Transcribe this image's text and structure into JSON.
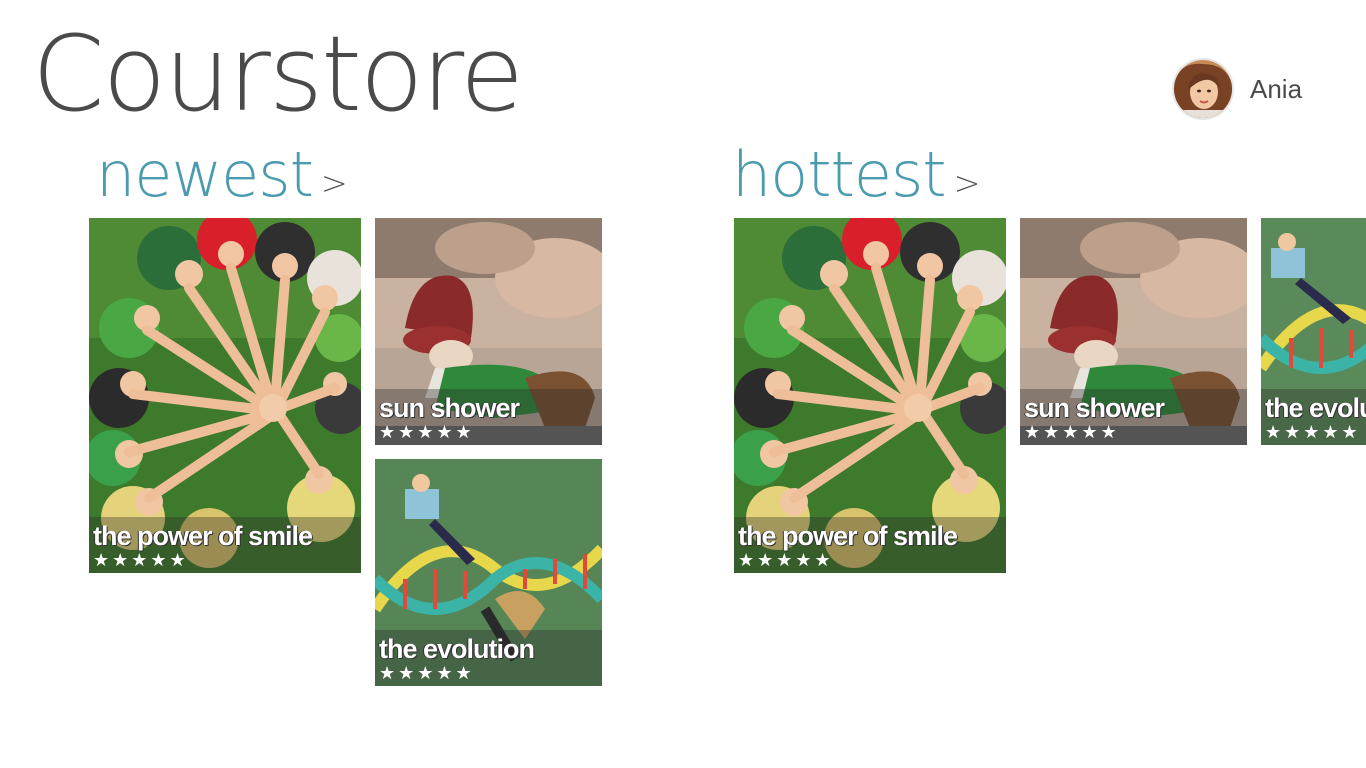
{
  "app": {
    "title": "Courstore"
  },
  "user": {
    "name": "Ania"
  },
  "sections": [
    {
      "title": "newest",
      "chevron": ">",
      "tiles": [
        {
          "title": "the power of smile",
          "stars": "★★★★★"
        },
        {
          "title": "sun shower",
          "stars": "★★★★★"
        },
        {
          "title": "the evolution",
          "stars": "★★★★★"
        }
      ]
    },
    {
      "title": "hottest",
      "chevron": ">",
      "tiles": [
        {
          "title": "the power of smile",
          "stars": "★★★★★"
        },
        {
          "title": "sun shower",
          "stars": "★★★★★"
        },
        {
          "title": "the evolution",
          "stars": "★★★★★"
        }
      ]
    }
  ]
}
